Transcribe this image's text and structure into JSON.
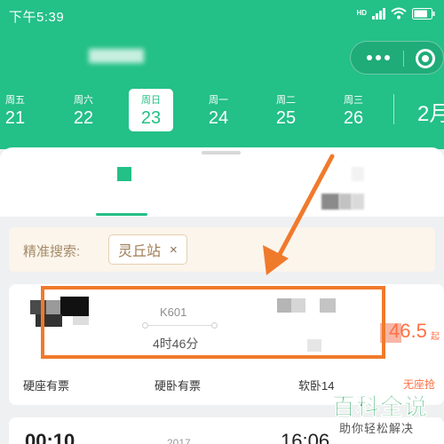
{
  "status_bar": {
    "time": "下午5:39",
    "network": "HD",
    "battery_level": 0.8
  },
  "header": {
    "capsule_icons": [
      "more-dots-icon",
      "close-circle-icon"
    ]
  },
  "date_strip": {
    "days": [
      {
        "weekday": "周五",
        "day": "21"
      },
      {
        "weekday": "周六",
        "day": "22"
      },
      {
        "weekday": "周日",
        "day": "23",
        "selected": true
      },
      {
        "weekday": "周一",
        "day": "24"
      },
      {
        "weekday": "周二",
        "day": "25"
      },
      {
        "weekday": "周三",
        "day": "26"
      }
    ],
    "month_label": "2月"
  },
  "filter": {
    "label": "精准搜索:",
    "chip_label": "灵丘站",
    "chip_remove": "×"
  },
  "train": {
    "number": "K601",
    "duration": "4时46分",
    "price": "46.5",
    "price_unit": "起",
    "seats": [
      "硬座有票",
      "硬卧有票",
      "软卧14"
    ],
    "seat_warning": "无座抢"
  },
  "next_train": {
    "depart": "00:10",
    "number": "2017",
    "arrive": "16:06"
  },
  "watermark": {
    "title": "百科全说",
    "subtitle": "助你轻松解决"
  },
  "colors": {
    "brand_green": "#23c087",
    "annotation_orange": "#f07a2c",
    "price_orange": "#ff7044",
    "chip_brown": "#a07b55"
  }
}
